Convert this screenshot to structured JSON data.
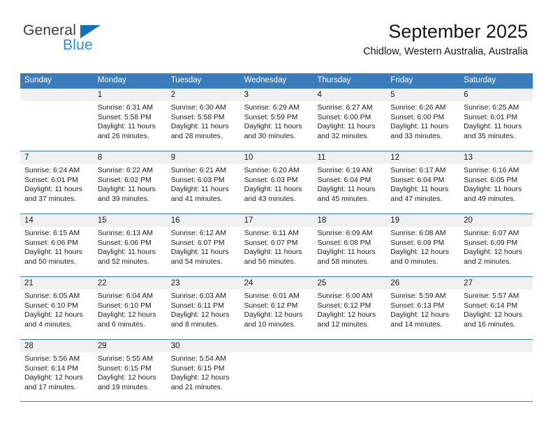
{
  "brand": {
    "name_top": "General",
    "name_bottom": "Blue",
    "triangle_color": "#1271b8",
    "blue_text_color": "#2a8fd8"
  },
  "header": {
    "title": "September 2025",
    "subtitle": "Chidlow, Western Australia, Australia",
    "header_bg_color": "#3b7cbd",
    "day_band_color": "#f0f0f0"
  },
  "weekdays": [
    "Sunday",
    "Monday",
    "Tuesday",
    "Wednesday",
    "Thursday",
    "Friday",
    "Saturday"
  ],
  "weeks": [
    [
      {
        "day": "",
        "sunrise": "",
        "sunset": "",
        "daylight_line1": "",
        "daylight_line2": "",
        "empty": true
      },
      {
        "day": "1",
        "sunrise": "Sunrise: 6:31 AM",
        "sunset": "Sunset: 5:58 PM",
        "daylight_line1": "Daylight: 11 hours",
        "daylight_line2": "and 26 minutes."
      },
      {
        "day": "2",
        "sunrise": "Sunrise: 6:30 AM",
        "sunset": "Sunset: 5:58 PM",
        "daylight_line1": "Daylight: 11 hours",
        "daylight_line2": "and 28 minutes."
      },
      {
        "day": "3",
        "sunrise": "Sunrise: 6:29 AM",
        "sunset": "Sunset: 5:59 PM",
        "daylight_line1": "Daylight: 11 hours",
        "daylight_line2": "and 30 minutes."
      },
      {
        "day": "4",
        "sunrise": "Sunrise: 6:27 AM",
        "sunset": "Sunset: 6:00 PM",
        "daylight_line1": "Daylight: 11 hours",
        "daylight_line2": "and 32 minutes."
      },
      {
        "day": "5",
        "sunrise": "Sunrise: 6:26 AM",
        "sunset": "Sunset: 6:00 PM",
        "daylight_line1": "Daylight: 11 hours",
        "daylight_line2": "and 33 minutes."
      },
      {
        "day": "6",
        "sunrise": "Sunrise: 6:25 AM",
        "sunset": "Sunset: 6:01 PM",
        "daylight_line1": "Daylight: 11 hours",
        "daylight_line2": "and 35 minutes."
      }
    ],
    [
      {
        "day": "7",
        "sunrise": "Sunrise: 6:24 AM",
        "sunset": "Sunset: 6:01 PM",
        "daylight_line1": "Daylight: 11 hours",
        "daylight_line2": "and 37 minutes."
      },
      {
        "day": "8",
        "sunrise": "Sunrise: 6:22 AM",
        "sunset": "Sunset: 6:02 PM",
        "daylight_line1": "Daylight: 11 hours",
        "daylight_line2": "and 39 minutes."
      },
      {
        "day": "9",
        "sunrise": "Sunrise: 6:21 AM",
        "sunset": "Sunset: 6:03 PM",
        "daylight_line1": "Daylight: 11 hours",
        "daylight_line2": "and 41 minutes."
      },
      {
        "day": "10",
        "sunrise": "Sunrise: 6:20 AM",
        "sunset": "Sunset: 6:03 PM",
        "daylight_line1": "Daylight: 11 hours",
        "daylight_line2": "and 43 minutes."
      },
      {
        "day": "11",
        "sunrise": "Sunrise: 6:19 AM",
        "sunset": "Sunset: 6:04 PM",
        "daylight_line1": "Daylight: 11 hours",
        "daylight_line2": "and 45 minutes."
      },
      {
        "day": "12",
        "sunrise": "Sunrise: 6:17 AM",
        "sunset": "Sunset: 6:04 PM",
        "daylight_line1": "Daylight: 11 hours",
        "daylight_line2": "and 47 minutes."
      },
      {
        "day": "13",
        "sunrise": "Sunrise: 6:16 AM",
        "sunset": "Sunset: 6:05 PM",
        "daylight_line1": "Daylight: 11 hours",
        "daylight_line2": "and 49 minutes."
      }
    ],
    [
      {
        "day": "14",
        "sunrise": "Sunrise: 6:15 AM",
        "sunset": "Sunset: 6:06 PM",
        "daylight_line1": "Daylight: 11 hours",
        "daylight_line2": "and 50 minutes."
      },
      {
        "day": "15",
        "sunrise": "Sunrise: 6:13 AM",
        "sunset": "Sunset: 6:06 PM",
        "daylight_line1": "Daylight: 11 hours",
        "daylight_line2": "and 52 minutes."
      },
      {
        "day": "16",
        "sunrise": "Sunrise: 6:12 AM",
        "sunset": "Sunset: 6:07 PM",
        "daylight_line1": "Daylight: 11 hours",
        "daylight_line2": "and 54 minutes."
      },
      {
        "day": "17",
        "sunrise": "Sunrise: 6:11 AM",
        "sunset": "Sunset: 6:07 PM",
        "daylight_line1": "Daylight: 11 hours",
        "daylight_line2": "and 56 minutes."
      },
      {
        "day": "18",
        "sunrise": "Sunrise: 6:09 AM",
        "sunset": "Sunset: 6:08 PM",
        "daylight_line1": "Daylight: 11 hours",
        "daylight_line2": "and 58 minutes."
      },
      {
        "day": "19",
        "sunrise": "Sunrise: 6:08 AM",
        "sunset": "Sunset: 6:09 PM",
        "daylight_line1": "Daylight: 12 hours",
        "daylight_line2": "and 0 minutes."
      },
      {
        "day": "20",
        "sunrise": "Sunrise: 6:07 AM",
        "sunset": "Sunset: 6:09 PM",
        "daylight_line1": "Daylight: 12 hours",
        "daylight_line2": "and 2 minutes."
      }
    ],
    [
      {
        "day": "21",
        "sunrise": "Sunrise: 6:05 AM",
        "sunset": "Sunset: 6:10 PM",
        "daylight_line1": "Daylight: 12 hours",
        "daylight_line2": "and 4 minutes."
      },
      {
        "day": "22",
        "sunrise": "Sunrise: 6:04 AM",
        "sunset": "Sunset: 6:10 PM",
        "daylight_line1": "Daylight: 12 hours",
        "daylight_line2": "and 6 minutes."
      },
      {
        "day": "23",
        "sunrise": "Sunrise: 6:03 AM",
        "sunset": "Sunset: 6:11 PM",
        "daylight_line1": "Daylight: 12 hours",
        "daylight_line2": "and 8 minutes."
      },
      {
        "day": "24",
        "sunrise": "Sunrise: 6:01 AM",
        "sunset": "Sunset: 6:12 PM",
        "daylight_line1": "Daylight: 12 hours",
        "daylight_line2": "and 10 minutes."
      },
      {
        "day": "25",
        "sunrise": "Sunrise: 6:00 AM",
        "sunset": "Sunset: 6:12 PM",
        "daylight_line1": "Daylight: 12 hours",
        "daylight_line2": "and 12 minutes."
      },
      {
        "day": "26",
        "sunrise": "Sunrise: 5:59 AM",
        "sunset": "Sunset: 6:13 PM",
        "daylight_line1": "Daylight: 12 hours",
        "daylight_line2": "and 14 minutes."
      },
      {
        "day": "27",
        "sunrise": "Sunrise: 5:57 AM",
        "sunset": "Sunset: 6:14 PM",
        "daylight_line1": "Daylight: 12 hours",
        "daylight_line2": "and 16 minutes."
      }
    ],
    [
      {
        "day": "28",
        "sunrise": "Sunrise: 5:56 AM",
        "sunset": "Sunset: 6:14 PM",
        "daylight_line1": "Daylight: 12 hours",
        "daylight_line2": "and 17 minutes."
      },
      {
        "day": "29",
        "sunrise": "Sunrise: 5:55 AM",
        "sunset": "Sunset: 6:15 PM",
        "daylight_line1": "Daylight: 12 hours",
        "daylight_line2": "and 19 minutes."
      },
      {
        "day": "30",
        "sunrise": "Sunrise: 5:54 AM",
        "sunset": "Sunset: 6:15 PM",
        "daylight_line1": "Daylight: 12 hours",
        "daylight_line2": "and 21 minutes."
      },
      {
        "day": "",
        "sunrise": "",
        "sunset": "",
        "daylight_line1": "",
        "daylight_line2": "",
        "empty": true
      },
      {
        "day": "",
        "sunrise": "",
        "sunset": "",
        "daylight_line1": "",
        "daylight_line2": "",
        "empty": true
      },
      {
        "day": "",
        "sunrise": "",
        "sunset": "",
        "daylight_line1": "",
        "daylight_line2": "",
        "empty": true
      },
      {
        "day": "",
        "sunrise": "",
        "sunset": "",
        "daylight_line1": "",
        "daylight_line2": "",
        "empty": true
      }
    ]
  ]
}
